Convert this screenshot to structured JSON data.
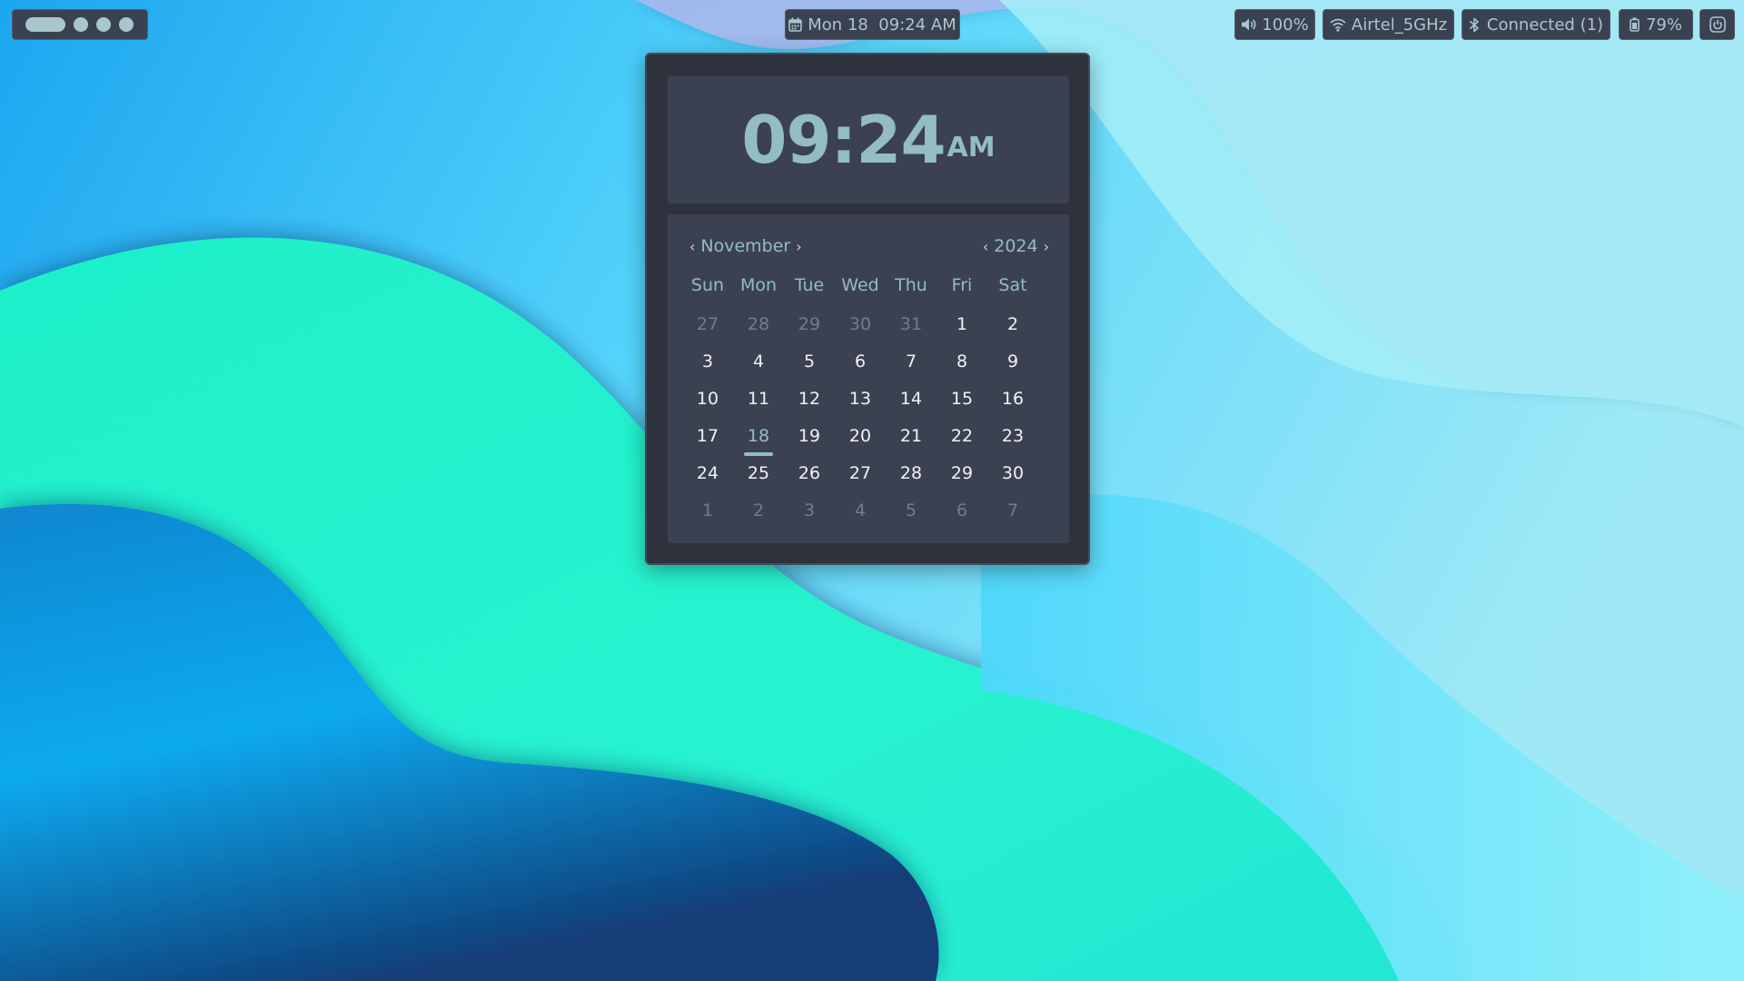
{
  "topbar": {
    "clock": {
      "text": "Mon 18  09:24 AM"
    },
    "volume": {
      "text": "100%"
    },
    "wifi": {
      "text": "Airtel_5GHz"
    },
    "bluetooth": {
      "text": "Connected (1)"
    },
    "battery": {
      "text": "79%"
    }
  },
  "popup": {
    "time": "09:24",
    "ampm": "AM",
    "month": "November",
    "year": "2024",
    "weekdays": [
      "Sun",
      "Mon",
      "Tue",
      "Wed",
      "Thu",
      "Fri",
      "Sat"
    ],
    "days": [
      {
        "d": "27",
        "muted": true
      },
      {
        "d": "28",
        "muted": true
      },
      {
        "d": "29",
        "muted": true
      },
      {
        "d": "30",
        "muted": true
      },
      {
        "d": "31",
        "muted": true
      },
      {
        "d": "1"
      },
      {
        "d": "2"
      },
      {
        "d": "3"
      },
      {
        "d": "4"
      },
      {
        "d": "5"
      },
      {
        "d": "6"
      },
      {
        "d": "7"
      },
      {
        "d": "8"
      },
      {
        "d": "9"
      },
      {
        "d": "10"
      },
      {
        "d": "11"
      },
      {
        "d": "12"
      },
      {
        "d": "13"
      },
      {
        "d": "14"
      },
      {
        "d": "15"
      },
      {
        "d": "16"
      },
      {
        "d": "17"
      },
      {
        "d": "18",
        "today": true
      },
      {
        "d": "19"
      },
      {
        "d": "20"
      },
      {
        "d": "21"
      },
      {
        "d": "22"
      },
      {
        "d": "23"
      },
      {
        "d": "24"
      },
      {
        "d": "25"
      },
      {
        "d": "26"
      },
      {
        "d": "27"
      },
      {
        "d": "28"
      },
      {
        "d": "29"
      },
      {
        "d": "30"
      },
      {
        "d": "1",
        "muted": true
      },
      {
        "d": "2",
        "muted": true
      },
      {
        "d": "3",
        "muted": true
      },
      {
        "d": "4",
        "muted": true
      },
      {
        "d": "5",
        "muted": true
      },
      {
        "d": "6",
        "muted": true
      },
      {
        "d": "7",
        "muted": true
      }
    ]
  },
  "colors": {
    "bar_bg": "#3a4150",
    "accent": "#93bdc0",
    "popup_bg": "#2d323d",
    "card_bg": "#3b4151"
  }
}
